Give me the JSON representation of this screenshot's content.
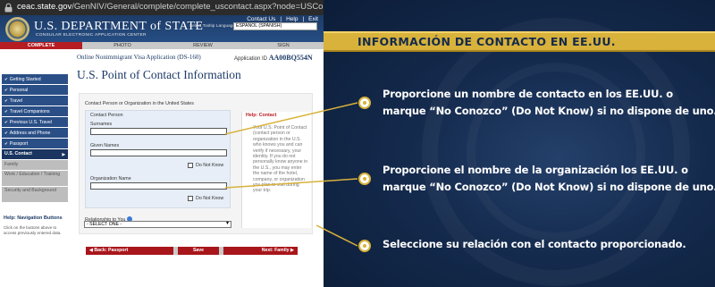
{
  "browser": {
    "url_host": "ceac.state.gov",
    "url_path": "/GenNIV/General/complete/complete_uscontact.aspx?node=USContact"
  },
  "site": {
    "header_links": [
      "Contact Us",
      "Help",
      "Exit"
    ],
    "logo_title": "U.S. DEPARTMENT of STATE",
    "logo_subtitle": "CONSULAR ELECTRONIC APPLICATION CENTER",
    "language_label": "Select Tooltip Language",
    "language_value": "ESPAÑOL (SPANISH)",
    "steps": [
      "COMPLETE",
      "PHOTO",
      "REVIEW",
      "SIGN"
    ],
    "application_title": "Online Nonimmigrant Visa Application (DS-160)",
    "application_id_label": "Application ID",
    "application_id": "AA00BQ554N",
    "page_title": "U.S. Point of Contact Information",
    "sidebar": [
      {
        "label": "Getting Started",
        "state": "done"
      },
      {
        "label": "Personal",
        "state": "done"
      },
      {
        "label": "Travel",
        "state": "done"
      },
      {
        "label": "Travel Companions",
        "state": "done"
      },
      {
        "label": "Previous U.S. Travel",
        "state": "done"
      },
      {
        "label": "Address and Phone",
        "state": "done"
      },
      {
        "label": "Passport",
        "state": "done"
      },
      {
        "label": "U.S. Contact",
        "state": "current"
      },
      {
        "label": "Family",
        "state": "pending"
      },
      {
        "label": "Work / Education / Training",
        "state": "pending"
      },
      {
        "label": "Security and Background",
        "state": "pending"
      }
    ],
    "help_nav_title": "Help: Navigation Buttons",
    "help_nav_text": "Click on the buttons above to access previously entered data.",
    "form": {
      "section_label": "Contact Person or Organization in the United States",
      "contact_person_label": "Contact Person",
      "surnames_label": "Surnames",
      "surnames_value": "",
      "given_names_label": "Given Names",
      "given_names_value": "",
      "do_not_know_label": "Do Not Know",
      "organization_label": "Organization Name",
      "organization_value": "",
      "relationship_label": "Relationship to You",
      "relationship_value": "- SELECT ONE -"
    },
    "help_contact_title": "Help: Contact",
    "help_contact_body": "Your U.S. Point of Contact (contact person or organization in the U.S. who knows you and can verify if necessary, your identity. If you do not personally know anyone in the U.S., you may enter the name of the hotel, company, or organization you plan to visit during your trip.",
    "nav_buttons": {
      "back": "◀ Back: Passport",
      "save": "Save",
      "next": "Next: Family ▶"
    }
  },
  "tutorial": {
    "banner_title": "INFORMACIÓN DE CONTACTO EN EE.UU.",
    "notes": [
      [
        "Proporcione un nombre de contacto en los EE.UU. o",
        "marque “No Conozco” (Do Not Know) si no dispone de uno."
      ],
      [
        "Proporcione el nombre de la organización los EE.UU. o",
        "marque “No Conozco” (Do Not Know) si no dispone de uno."
      ],
      [
        "Seleccione su relación con el contacto proporcionado."
      ]
    ]
  },
  "colors": {
    "banner": "#d8b23a",
    "navy": "#142a4d",
    "site_red": "#b51d22"
  }
}
